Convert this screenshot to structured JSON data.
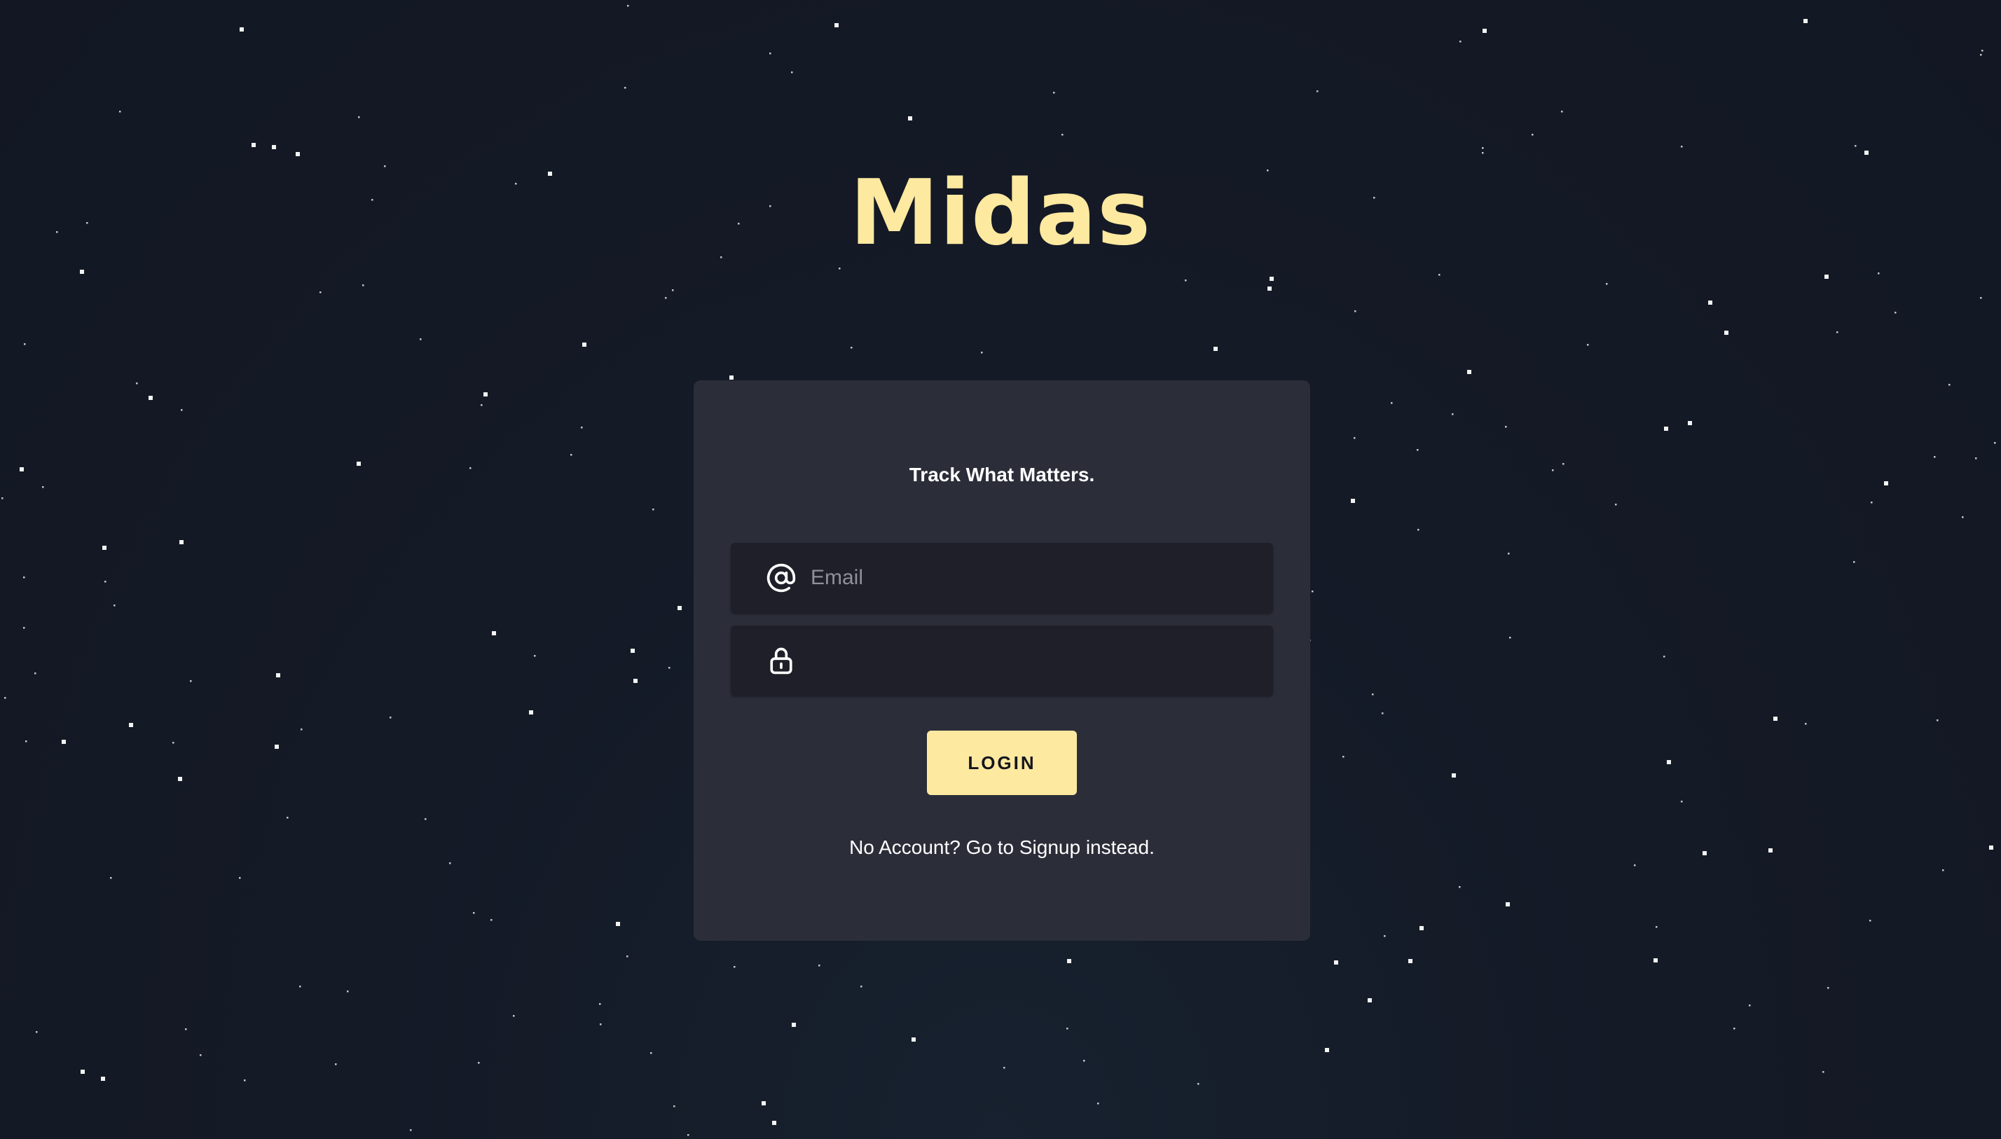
{
  "app": {
    "title": "Midas",
    "tagline": "Track What Matters."
  },
  "login_form": {
    "email": {
      "placeholder": "Email",
      "value": "",
      "icon": "at-sign-icon"
    },
    "password": {
      "placeholder": "",
      "value": "",
      "icon": "lock-icon"
    },
    "submit_label": "LOGIN",
    "signup_prompt": "No Account? Go to Signup instead."
  },
  "colors": {
    "accent": "#fee9a0",
    "card_background": "#2b2e39",
    "field_background": "#1e1f28",
    "page_background": "#141a26",
    "text": "#ffffff",
    "star": "#ffffff"
  }
}
